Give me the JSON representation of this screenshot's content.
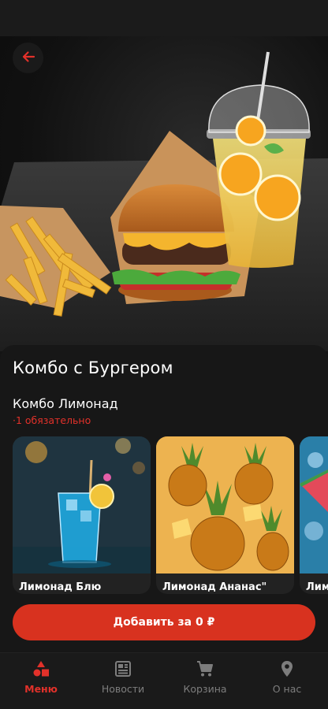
{
  "product": {
    "title": "Комбо с Бургером"
  },
  "group": {
    "title": "Комбо Лимонад",
    "note": "·1 обязательно"
  },
  "options": [
    {
      "label": "Лимонад Блю"
    },
    {
      "label": "Лимонад Ананас\""
    },
    {
      "label": "Лим"
    }
  ],
  "cta": {
    "label": "Добавить за 0 ₽"
  },
  "tabs": [
    {
      "label": "Меню",
      "icon": "shapes-icon",
      "active": true
    },
    {
      "label": "Новости",
      "icon": "newspaper-icon",
      "active": false
    },
    {
      "label": "Корзина",
      "icon": "cart-icon",
      "active": false
    },
    {
      "label": "О нас",
      "icon": "location-pin-icon",
      "active": false
    }
  ],
  "colors": {
    "accent": "#e2312a",
    "button": "#d8321f",
    "background": "#171717"
  }
}
